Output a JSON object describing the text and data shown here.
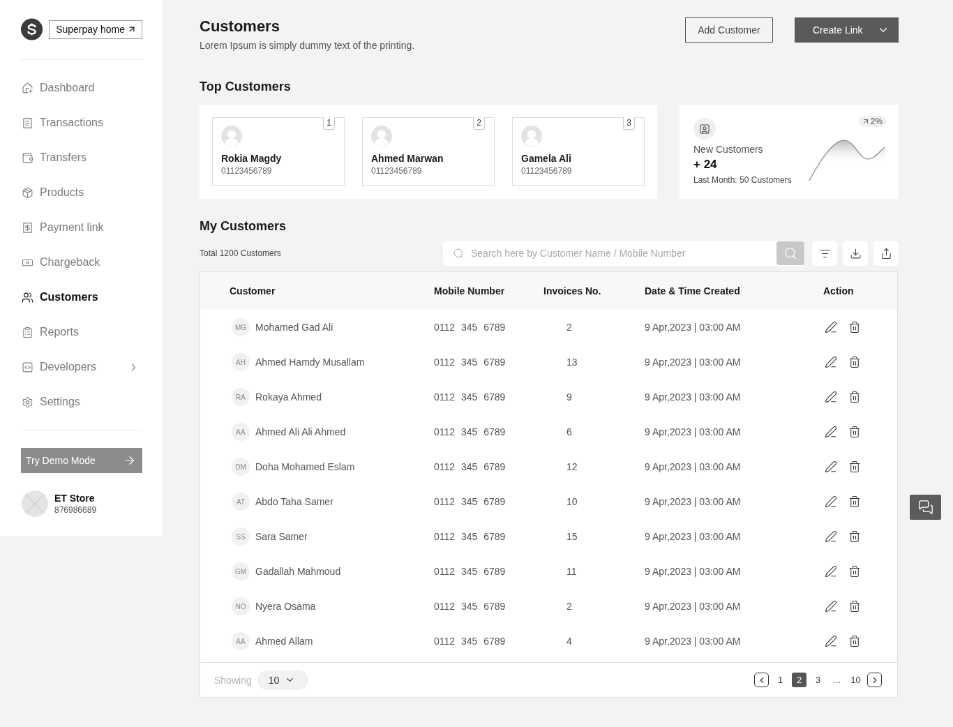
{
  "sidebar": {
    "home_link": "Superpay home",
    "nav": [
      {
        "label": "Dashboard",
        "selected": false,
        "has_submenu": false
      },
      {
        "label": "Transactions",
        "selected": false,
        "has_submenu": false
      },
      {
        "label": "Transfers",
        "selected": false,
        "has_submenu": false
      },
      {
        "label": "Products",
        "selected": false,
        "has_submenu": false
      },
      {
        "label": "Payment link",
        "selected": false,
        "has_submenu": false
      },
      {
        "label": "Chargeback",
        "selected": false,
        "has_submenu": false
      },
      {
        "label": "Customers",
        "selected": true,
        "has_submenu": false
      },
      {
        "label": "Reports",
        "selected": false,
        "has_submenu": false
      },
      {
        "label": "Developers",
        "selected": false,
        "has_submenu": true
      },
      {
        "label": "Settings",
        "selected": false,
        "has_submenu": false
      }
    ],
    "demo_button": "Try Demo Mode",
    "account": {
      "name": "ET Store",
      "number": "876986689"
    }
  },
  "header": {
    "title": "Customers",
    "subtitle": "Lorem Ipsum is simply dummy text of the printing.",
    "secondary_action": "Add Customer",
    "primary_action": "Create Link"
  },
  "top_customers": {
    "title": "Top Customers",
    "cards": [
      {
        "rank": "1",
        "name": "Rokia Magdy",
        "phone": "01123456789"
      },
      {
        "rank": "2",
        "name": "Ahmed Marwan",
        "phone": "01123456789"
      },
      {
        "rank": "3",
        "name": "Gamela Ali",
        "phone": "01123456789"
      }
    ]
  },
  "new_customers": {
    "label": "New Customers",
    "value": "+ 24",
    "last_month": "Last Month: 50 Customers",
    "change": "2%"
  },
  "my_customers": {
    "title": "My Customers",
    "total": "Total 1200 Customers",
    "search": {
      "placeholder": "Search here by Customer Name / Mobile Number"
    }
  },
  "table": {
    "columns": [
      "Customer",
      "Mobile Number",
      "Invoices No.",
      "Date & Time Created",
      "Action"
    ],
    "rows": [
      {
        "initials": "MG",
        "name": "Mohamed Gad Ali",
        "mobile": "0112 345 6789",
        "invoices": "2",
        "created": "9 Apr,2023 | 03:00 AM"
      },
      {
        "initials": "AH",
        "name": "Ahmed Hamdy Musallam",
        "mobile": "0112 345 6789",
        "invoices": "13",
        "created": "9 Apr,2023 | 03:00 AM"
      },
      {
        "initials": "RA",
        "name": "Rokaya Ahmed",
        "mobile": "0112 345 6789",
        "invoices": "9",
        "created": "9 Apr,2023 | 03:00 AM"
      },
      {
        "initials": "AA",
        "name": "Ahmed Ali Ali Ahmed",
        "mobile": "0112 345 6789",
        "invoices": "6",
        "created": "9 Apr,2023 | 03:00 AM"
      },
      {
        "initials": "DM",
        "name": "Doha Mohamed Eslam",
        "mobile": "0112 345 6789",
        "invoices": "12",
        "created": "9 Apr,2023 | 03:00 AM"
      },
      {
        "initials": "AT",
        "name": "Abdo Taha Samer",
        "mobile": "0112 345 6789",
        "invoices": "10",
        "created": "9 Apr,2023 | 03:00 AM"
      },
      {
        "initials": "SS",
        "name": "Sara Samer",
        "mobile": "0112 345 6789",
        "invoices": "15",
        "created": "9 Apr,2023 | 03:00 AM"
      },
      {
        "initials": "GM",
        "name": "Gadallah Mahmoud",
        "mobile": "0112 345 6789",
        "invoices": "11",
        "created": "9 Apr,2023 | 03:00 AM"
      },
      {
        "initials": "NO",
        "name": "Nyera Osama",
        "mobile": "0112 345 6789",
        "invoices": "2",
        "created": "9 Apr,2023 | 03:00 AM"
      },
      {
        "initials": "AA",
        "name": "Ahmed Allam",
        "mobile": "0112 345 6789",
        "invoices": "4",
        "created": "9 Apr,2023 | 03:00 AM"
      }
    ],
    "footer": {
      "showing_label": "Showing",
      "page_size": "10",
      "pages": [
        {
          "label": "1",
          "selected": false
        },
        {
          "label": "2",
          "selected": true
        },
        {
          "label": "3",
          "selected": false
        },
        {
          "label": "...",
          "selected": false
        },
        {
          "label": "10",
          "selected": false
        }
      ]
    }
  }
}
